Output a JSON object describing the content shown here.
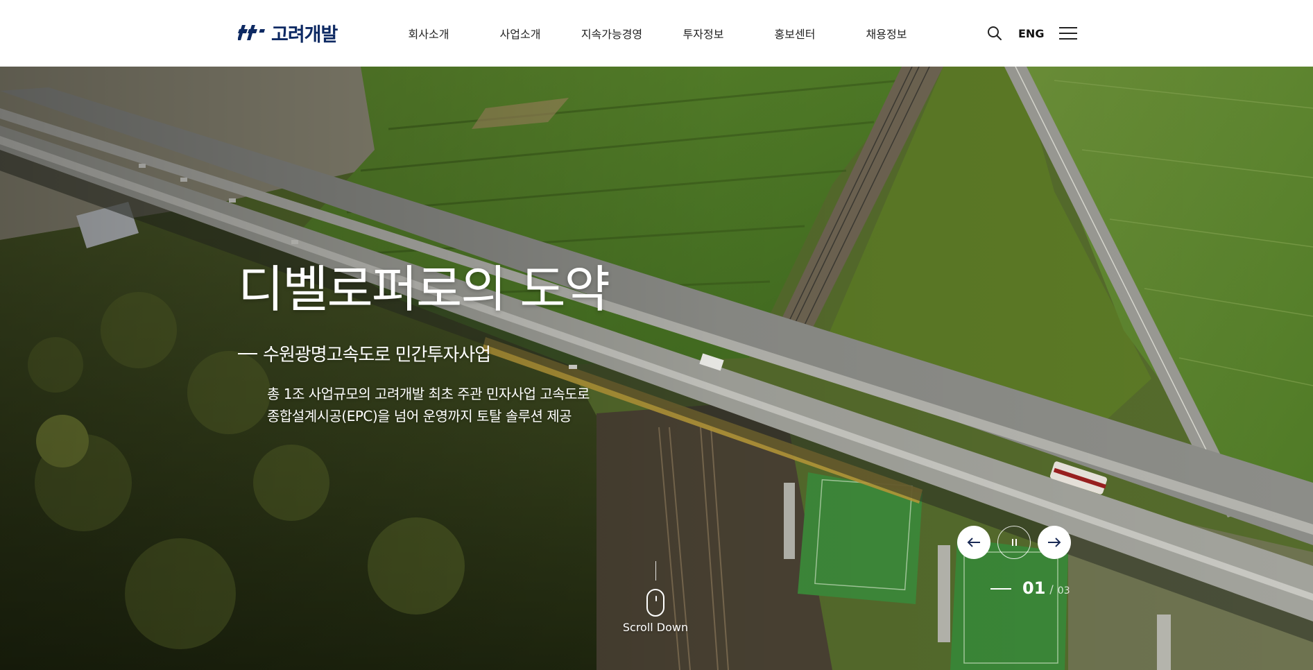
{
  "header": {
    "logo_text": "고려개발",
    "nav": [
      "회사소개",
      "사업소개",
      "지속가능경영",
      "투자정보",
      "홍보센터",
      "채용정보"
    ],
    "lang_label": "ENG",
    "icons": {
      "search": "search-icon",
      "menu": "hamburger-menu-icon"
    }
  },
  "hero": {
    "title": "디벨로퍼로의 도약",
    "subtitle": "수원광명고속도로 민간투자사업",
    "description_lines": [
      "총 1조 사업규모의 고려개발 최초 주관 민자사업 고속도로",
      "종합설계시공(EPC)을 넘어 운영까지 토탈 솔루션 제공"
    ],
    "slider": {
      "current": "01",
      "separator": "/",
      "total": "03"
    },
    "scroll_label": "Scroll Down",
    "icons": {
      "prev": "arrow-left-icon",
      "pause": "pause-icon",
      "next": "arrow-right-icon",
      "scroll": "mouse-icon"
    }
  },
  "colors": {
    "brand": "#0e2a63",
    "header_bg": "#ffffff",
    "hero_text": "#ffffff"
  }
}
